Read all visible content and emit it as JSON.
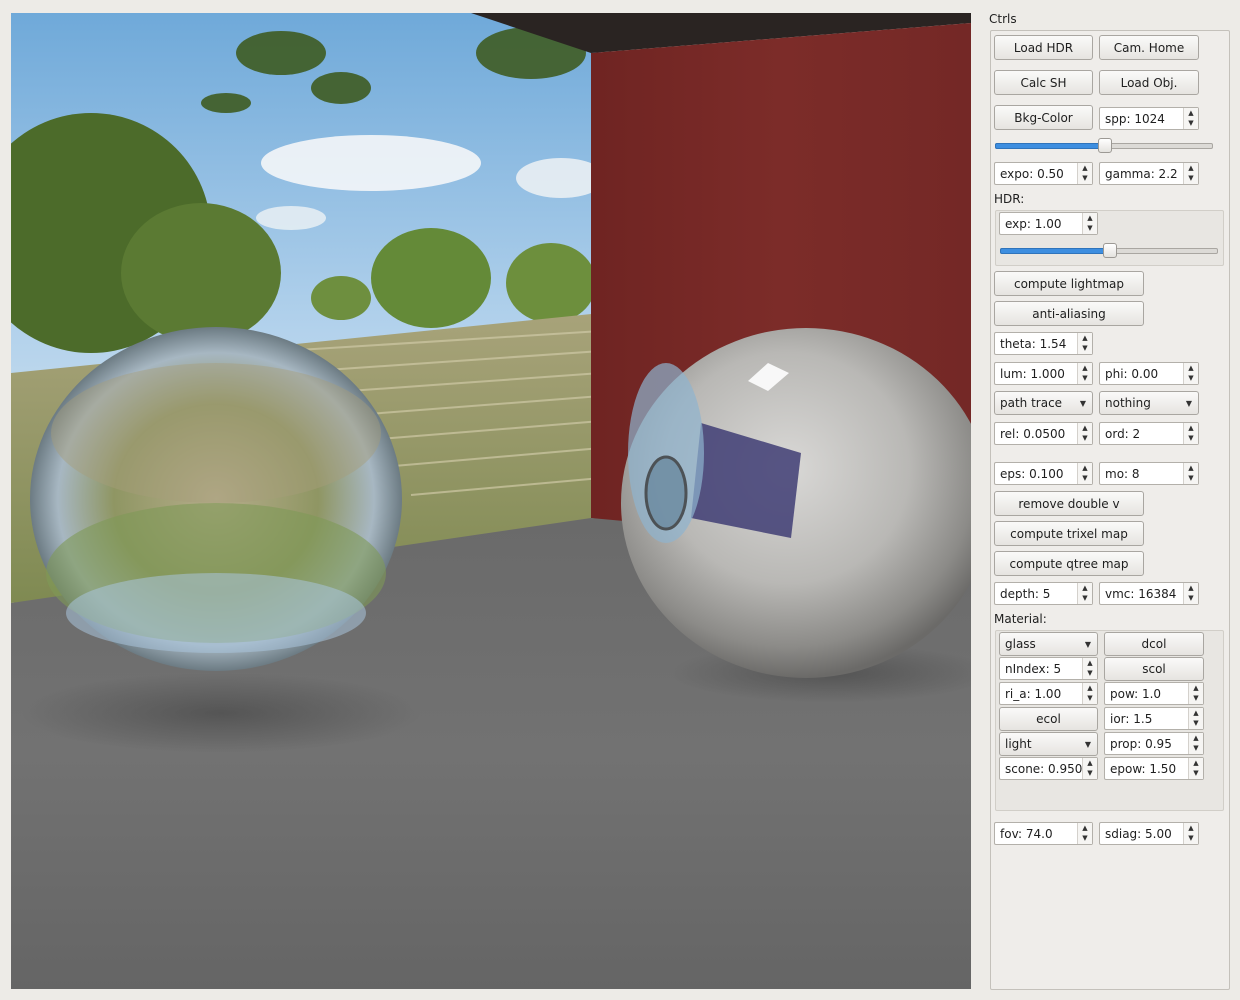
{
  "panel": {
    "title": "Ctrls",
    "buttons": {
      "load_hdr": "Load HDR",
      "cam_home": "Cam. Home",
      "calc_sh": "Calc SH",
      "load_obj": "Load Obj.",
      "bkg_color": "Bkg-Color",
      "compute_lightmap": "compute lightmap",
      "anti_aliasing": "anti-aliasing",
      "remove_double_v": "remove double v",
      "compute_trixel_map": "compute trixel map",
      "compute_qtree_map": "compute qtree map"
    },
    "spp": "spp: 1024",
    "spp_slider_fraction": 0.5,
    "expo": "expo: 0.50",
    "gamma": "gamma: 2.2",
    "hdr_label": "HDR:",
    "hdr_exp": "exp: 1.00",
    "hdr_slider_fraction": 0.5,
    "theta": "theta: 1.54",
    "lum": "lum: 1.000",
    "phi": "phi: 0.00",
    "render_mode": "path trace",
    "secondary_mode": "nothing",
    "rel": "rel: 0.0500",
    "ord": "ord: 2",
    "eps": "eps: 0.100",
    "mo": "mo: 8",
    "depth": "depth: 5",
    "vmc": "vmc: 16384",
    "material_label": "Material:",
    "material": {
      "type": "glass",
      "dcol": "dcol",
      "nindex": "nIndex: 5",
      "scol": "scol",
      "ri_a": "ri_a: 1.00",
      "pow": "pow: 1.0",
      "ecol": "ecol",
      "ior": "ior: 1.5",
      "light_mode": "light",
      "prop": "prop: 0.95",
      "scone": "scone: 0.950",
      "epow": "epow: 1.50"
    },
    "fov": "fov: 74.0",
    "sdiag": "sdiag: 5.00"
  },
  "icons": {
    "spin_up": "arrow-up",
    "spin_down": "arrow-down",
    "combo_caret": "chevron-down"
  },
  "colors": {
    "accent": "#3d8ee0",
    "wall": "#7a2a28",
    "floor": "#6e6e6e",
    "sky": "#8fc0e8"
  }
}
